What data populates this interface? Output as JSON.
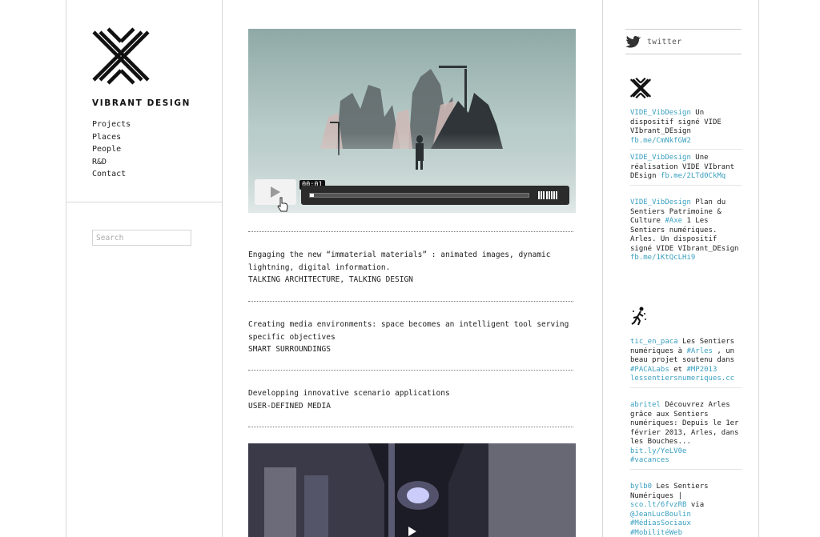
{
  "brand": {
    "name": "VIBRANT DESIGN"
  },
  "nav": {
    "items": [
      "Projects",
      "Places",
      "People",
      "R&D",
      "Contact"
    ]
  },
  "search": {
    "placeholder": "Search"
  },
  "video": {
    "time": "00:01",
    "progress": 0.01
  },
  "sections": [
    {
      "line1": "Engaging the new “immaterial materials” : animated images, dynamic lightning, digital information.",
      "line2": "TALKING ARCHITECTURE, TALKING DESIGN"
    },
    {
      "line1": "Creating media environments: space becomes an intelligent tool serving specific objectives",
      "line2": "SMART SURROUNDINGS"
    },
    {
      "line1": "Developping innovative scenario applications",
      "line2": "USER-DEFINED MEDIA"
    }
  ],
  "twitter": {
    "label": "twitter",
    "tweets_a": [
      {
        "user": "VIDE_VibDesign",
        "text": " Un dispositif signé VIDE VIbrant_DEsign ",
        "link": "fb.me/CmNkfGW2"
      },
      {
        "user": "VIDE_VibDesign",
        "text": " Une réalisation VIDE VIbrant DEsign ",
        "link": "fb.me/2LTd0CkMq"
      },
      {
        "user": "VIDE_VibDesign",
        "text1": " Plan du Sentiers Patrimoine & Culture ",
        "tag": "#Axe",
        "text2": " 1 Les Sentiers numériques. Arles. Un dispositif signé VIDE VIbrant_DEsign ",
        "link": "fb.me/1KtQcLHi9"
      }
    ],
    "tweets_b": [
      {
        "user": "tic_en_paca",
        "text1": " Les Sentiers numériques à ",
        "tag1": "#Arles",
        "text2": " , un beau projet soutenu dans ",
        "tag2": "#PACALabs",
        "text3": " et ",
        "tag3": "#MP2013",
        "link": "lessentiersnumeriques.cc"
      },
      {
        "user": "abritel",
        "text": " Découvrez Arles grâce aux Sentiers numériques: Depuis le 1er février 2013, Arles, dans les Bouches...",
        "link": "bit.ly/YeLV0e",
        "tag": "#vacances"
      },
      {
        "user": "bylb0",
        "text1": " Les Sentiers Numériques | ",
        "link": "sco.lt/6fvzRB",
        "text2": " via ",
        "mention": "@JeanLucBoulin",
        "tag1": "#MédiasSociaux",
        "tag2": "#MobilitéWeb"
      }
    ]
  },
  "colors": {
    "link": "#3aa0c0",
    "border": "#d8d8d8",
    "text": "#222222"
  }
}
